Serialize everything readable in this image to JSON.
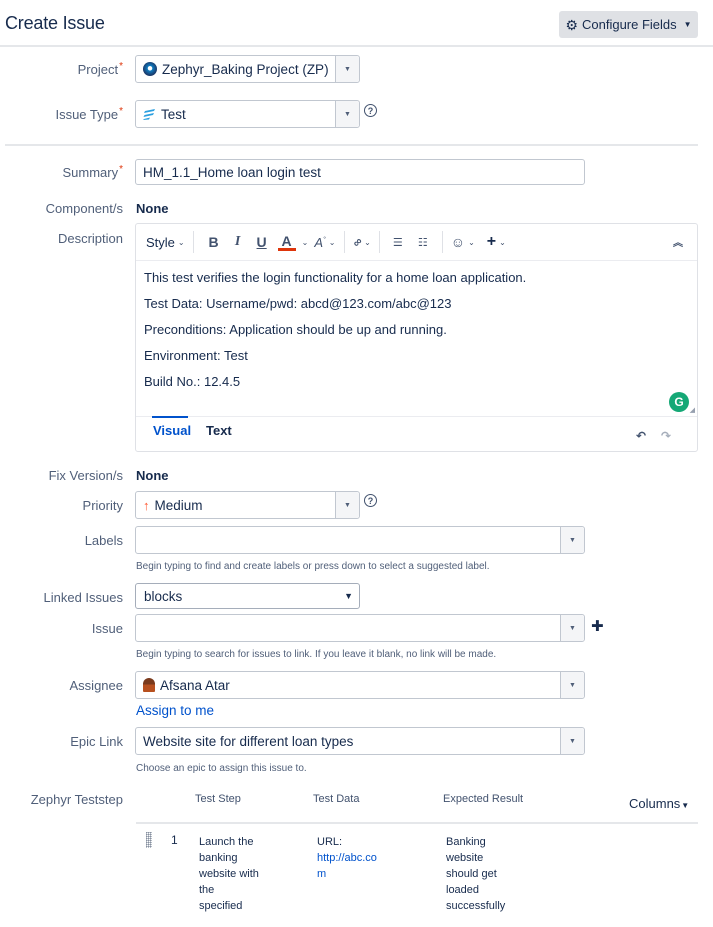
{
  "header": {
    "title": "Create Issue",
    "configure_fields": {
      "label": "Configure Fields",
      "icon": "gear-icon"
    }
  },
  "fields": {
    "project": {
      "label": "Project",
      "required": true,
      "value": "Zephyr_Baking Project (ZP)",
      "icon": "project-avatar-icon"
    },
    "issue_type": {
      "label": "Issue Type",
      "required": true,
      "value": "Test",
      "icon": "test-issue-type-icon"
    },
    "summary": {
      "label": "Summary",
      "required": true,
      "value": "HM_1.1_Home loan login test"
    },
    "components": {
      "label": "Component/s",
      "value": "None"
    },
    "description": {
      "label": "Description",
      "toolbar": {
        "style": "Style",
        "bold": "B",
        "italic": "I",
        "underline": "U",
        "text_color": "A",
        "more_format": "A",
        "link": "link",
        "bullet_list": "bullet-list",
        "numbered_list": "numbered-list",
        "emoji": "emoji",
        "insert": "+"
      },
      "lines": [
        "This test verifies the login functionality for a home loan application.",
        "Test Data: Username/pwd: abcd@123.com/abc@123",
        "Preconditions: Application should be up and running.",
        "Environment: Test",
        "Build No.: 12.4.5"
      ],
      "tabs": [
        {
          "label": "Visual",
          "active": true
        },
        {
          "label": "Text",
          "active": false
        }
      ],
      "accent_color": "#0052cc",
      "grammarly_color": "#15a876"
    },
    "fix_versions": {
      "label": "Fix Version/s",
      "value": "None"
    },
    "priority": {
      "label": "Priority",
      "value": "Medium",
      "icon": "arrow-up-icon",
      "icon_color": "#ff5630"
    },
    "labels": {
      "label": "Labels",
      "value": "",
      "hint": "Begin typing to find and create labels or press down to select a suggested label."
    },
    "linked_issues": {
      "label": "Linked Issues",
      "value": "blocks"
    },
    "issue": {
      "label": "Issue",
      "value": "",
      "hint": "Begin typing to search for issues to link. If you leave it blank, no link will be made."
    },
    "assignee": {
      "label": "Assignee",
      "value": "Afsana Atar",
      "assign_to_me": "Assign to me"
    },
    "epic_link": {
      "label": "Epic Link",
      "value": "Website site for different loan types",
      "hint": "Choose an epic to assign this issue to."
    }
  },
  "teststep": {
    "label": "Zephyr Teststep",
    "columns": [
      "Test Step",
      "Test Data",
      "Expected Result"
    ],
    "columns_button": "Columns",
    "rows": [
      {
        "number": "1",
        "test_step": [
          "Launch the",
          "banking",
          "website with",
          "the",
          "specified"
        ],
        "test_data_label": "URL:",
        "test_data_url": [
          "http://abc.co",
          "m"
        ],
        "expected_result": [
          "Banking",
          "website",
          "should get",
          "loaded",
          "successfully"
        ]
      }
    ]
  },
  "colors": {
    "required": "#de350b",
    "link": "#0052cc",
    "text": "#172b4d",
    "label": "#505f79"
  }
}
